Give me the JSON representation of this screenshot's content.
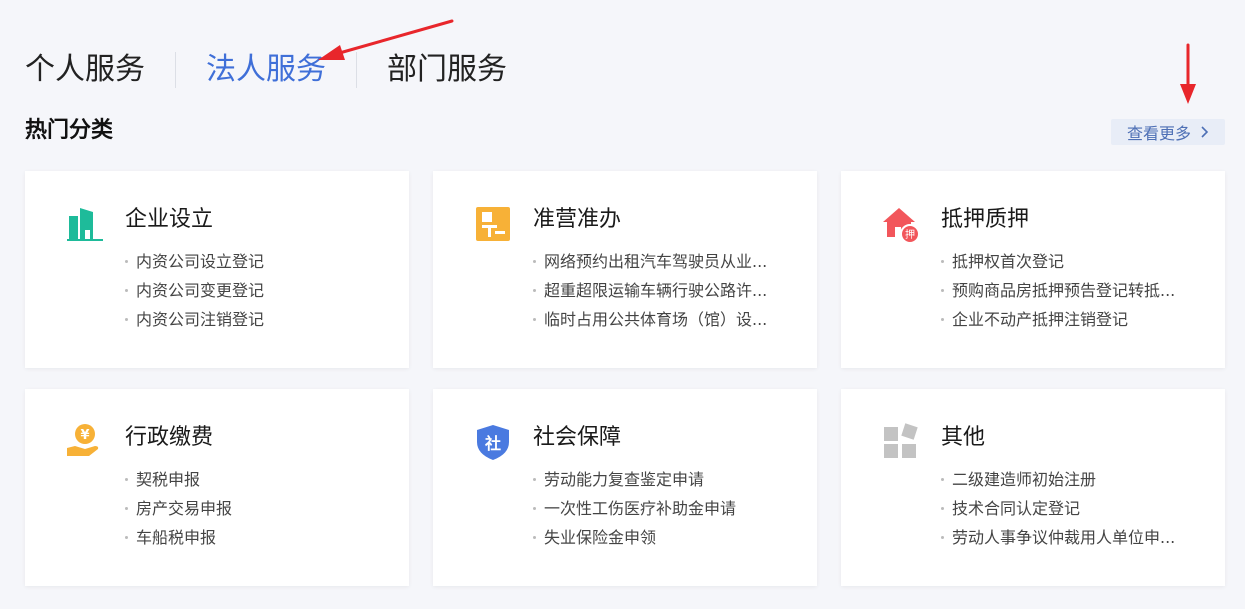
{
  "tabs": [
    {
      "label": "个人服务",
      "active": false
    },
    {
      "label": "法人服务",
      "active": true
    },
    {
      "label": "部门服务",
      "active": false
    }
  ],
  "section": {
    "title": "热门分类",
    "view_more": "查看更多"
  },
  "colors": {
    "accent": "#3f6fd8",
    "arrow": "#e8262b",
    "teal": "#1ebb9a",
    "orange": "#f7b137",
    "red": "#f2565b",
    "blue": "#4a7ae0",
    "gray": "#c3c3c3"
  },
  "cards": [
    {
      "title": "企业设立",
      "icon": "building-icon",
      "items": [
        "内资公司设立登记",
        "内资公司变更登记",
        "内资公司注销登记"
      ]
    },
    {
      "title": "准营准办",
      "icon": "license-icon",
      "items": [
        "网络预约出租汽车驾驶员从业...",
        "超重超限运输车辆行驶公路许...",
        "临时占用公共体育场（馆）设..."
      ]
    },
    {
      "title": "抵押质押",
      "icon": "house-mortgage-icon",
      "icon_badge": "押",
      "items": [
        "抵押权首次登记",
        "预购商品房抵押预告登记转抵...",
        "企业不动产抵押注销登记"
      ]
    },
    {
      "title": "行政缴费",
      "icon": "yen-payment-icon",
      "icon_symbol": "¥",
      "items": [
        "契税申报",
        "房产交易申报",
        "车船税申报"
      ]
    },
    {
      "title": "社会保障",
      "icon": "social-shield-icon",
      "icon_badge": "社",
      "items": [
        "劳动能力复查鉴定申请",
        "一次性工伤医疗补助金申请",
        "失业保险金申领"
      ]
    },
    {
      "title": "其他",
      "icon": "other-blocks-icon",
      "items": [
        "二级建造师初始注册",
        "技术合同认定登记",
        "劳动人事争议仲裁用人单位申..."
      ]
    }
  ]
}
